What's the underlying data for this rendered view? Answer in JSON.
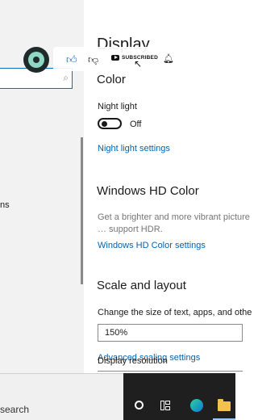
{
  "left": {
    "partial_label": "ns",
    "search_icon": "search-icon"
  },
  "display": {
    "title": "Display",
    "color_heading": "Color",
    "night_light_label": "Night light",
    "night_light_state": "Off",
    "night_light_settings_link": "Night light settings",
    "hd_heading": "Windows HD Color",
    "hd_desc": "Get a brighter and more vibrant picture … support HDR.",
    "hd_link": "Windows HD Color settings",
    "scale_heading": "Scale and layout",
    "scale_label": "Change the size of text, apps, and othe",
    "scale_value": "150%",
    "advanced_scaling_link": "Advanced scaling settings",
    "resolution_label": "Display resolution"
  },
  "youtube": {
    "subscribe_label": "SUBSCRIBED",
    "icons": [
      "like-icon",
      "dislike-icon",
      "subscribe-icon",
      "bell-icon"
    ]
  },
  "taskbar": {
    "search_text": "search",
    "icons": [
      "cortana-icon",
      "task-view-icon",
      "edge-icon",
      "file-explorer-icon"
    ]
  },
  "colors": {
    "link": "#0063b1",
    "taskbar": "#1f1f1f",
    "left_pane": "#f2f2f2"
  }
}
